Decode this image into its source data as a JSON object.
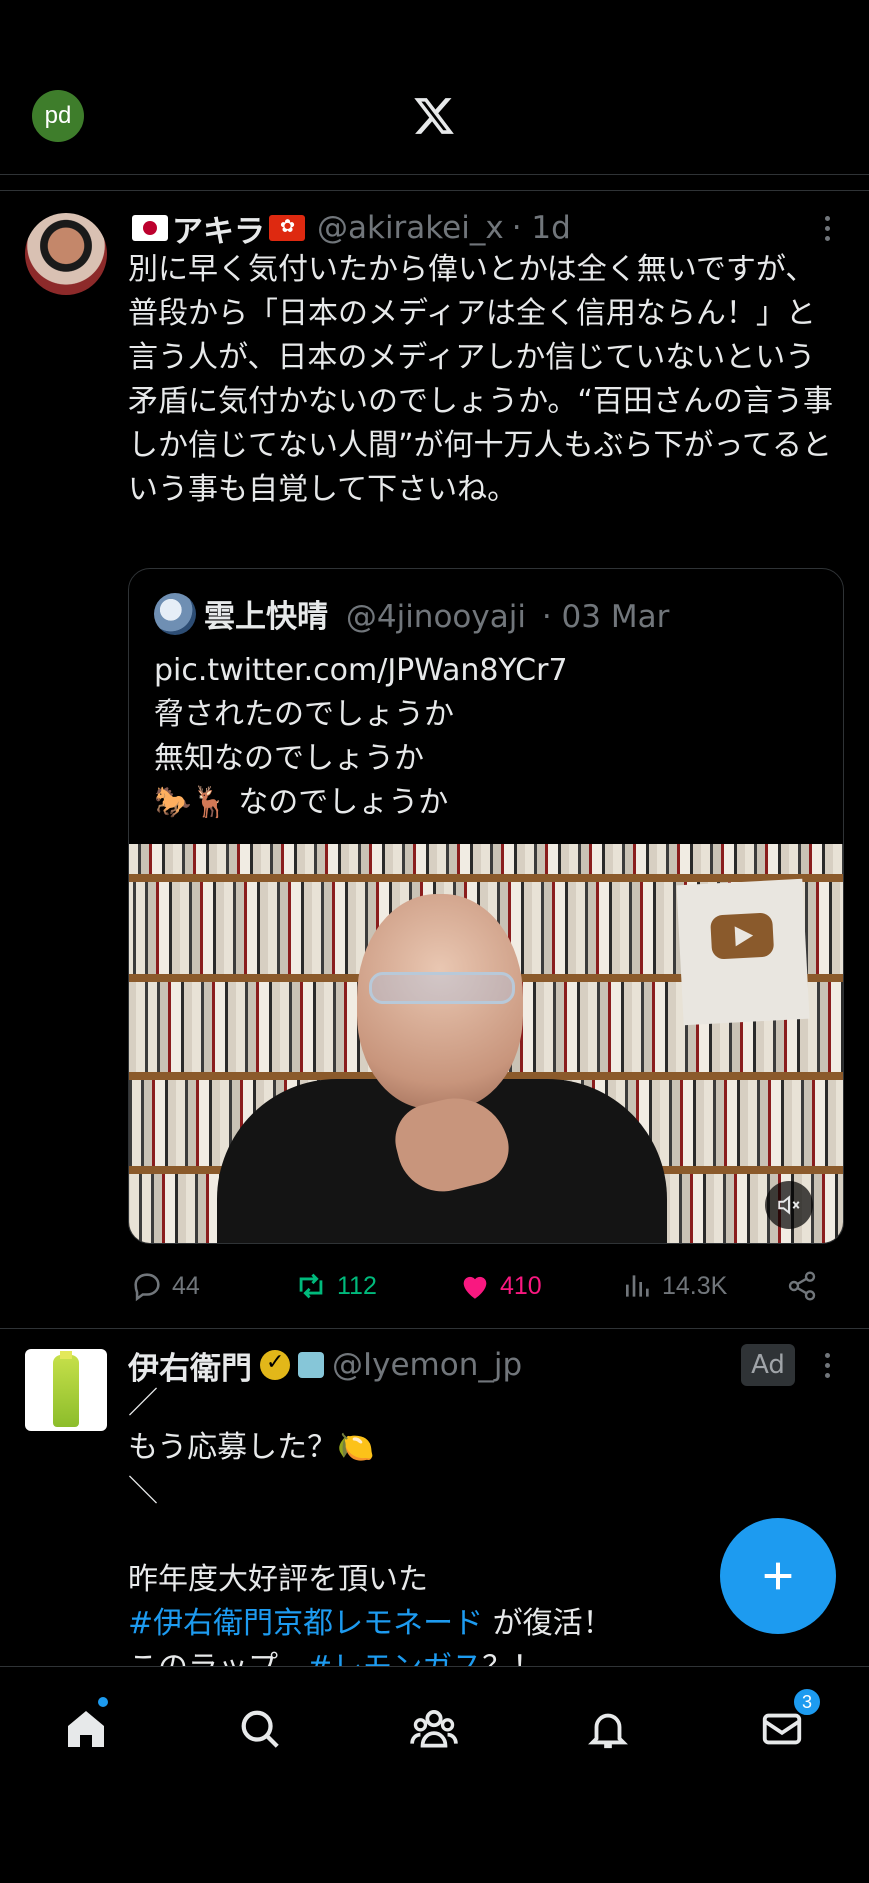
{
  "header": {
    "me_avatar_initials": "pd",
    "logo": "x-logo-icon"
  },
  "tweet1": {
    "display_name": "アキラ",
    "handle": "@akirakei_x",
    "time": "· 1d",
    "text": "別に早く気付いたから偉いとかは全く無いですが、普段から「日本のメディアは全く信用ならん！」と言う人が、日本のメディアしか信じていないという矛盾に気付かないのでしょうか。“百田さんの言う事しか信じてない人間”が何十万人もぶら下がってるという事も自覚して下さいね。",
    "quote": {
      "display_name": "雲上快晴",
      "handle": "@4jinooyaji",
      "time": "· 03 Mar",
      "text": "pic.twitter.com/JPWan8YCr7\n脅されたのでしょうか\n無知なのでしょうか\n🐎🦌 なのでしょうか"
    },
    "actions": {
      "replies": "44",
      "retweets": "112",
      "likes": "410",
      "views": "14.3K"
    }
  },
  "tweet2": {
    "display_name": "伊右衛門",
    "handle": "@Iyemon_jp",
    "ad_label": "Ad",
    "line1": "／",
    "line2": "もう応募した？🍋",
    "line3": "＼",
    "line4": "",
    "line5": "昨年度大好評を頂いた",
    "hashtag1": "#伊右衛門京都レモネード",
    "line6_suffix": " が復活！",
    "line7_prefix": "このラップ、",
    "hashtag2": "#レモンガス",
    "line7_suffix": "？！"
  },
  "nav": {
    "messages_badge": "3"
  },
  "colors": {
    "accent": "#1d9bf0",
    "retweet": "#00ba7c",
    "like": "#f91880",
    "muted": "#71767b"
  }
}
